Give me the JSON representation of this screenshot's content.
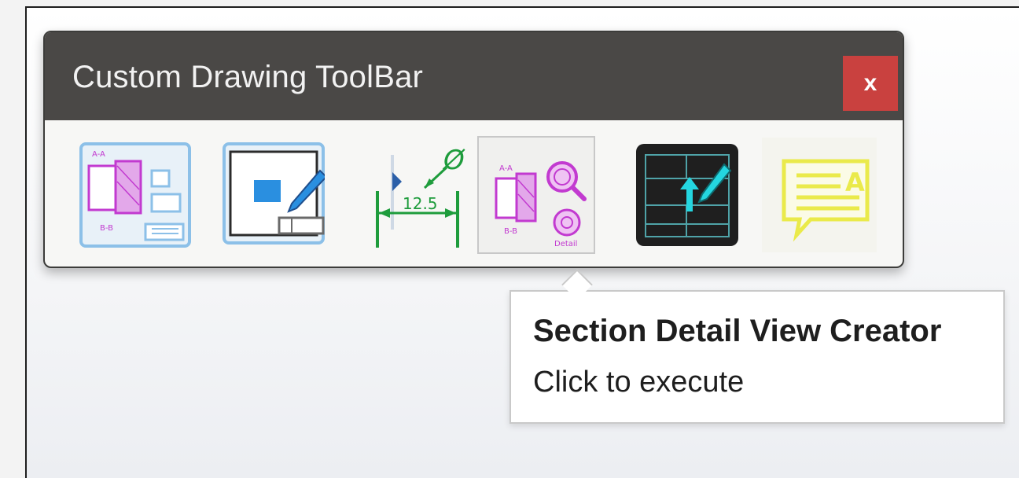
{
  "toolbar": {
    "title": "Custom Drawing ToolBar",
    "close_label": "x",
    "buttons": [
      {
        "icon": "section-layout-icon"
      },
      {
        "icon": "edit-view-icon"
      },
      {
        "icon": "dimension-icon",
        "dimension_text": "12.5",
        "diameter_symbol": "Ø"
      },
      {
        "icon": "section-detail-view-icon",
        "hovered": true
      },
      {
        "icon": "update-title-block-icon"
      },
      {
        "icon": "note-annotation-icon"
      }
    ]
  },
  "tooltip": {
    "title": "Section Detail View Creator",
    "subtitle": "Click to execute"
  },
  "colors": {
    "titlebar": "#4a4846",
    "close_button": "#c9413f",
    "magenta": "#c23ad0",
    "blue": "#2a8fe0",
    "green": "#1e9c3c",
    "cyan": "#24d6e0",
    "yellow": "#eaea4a"
  }
}
